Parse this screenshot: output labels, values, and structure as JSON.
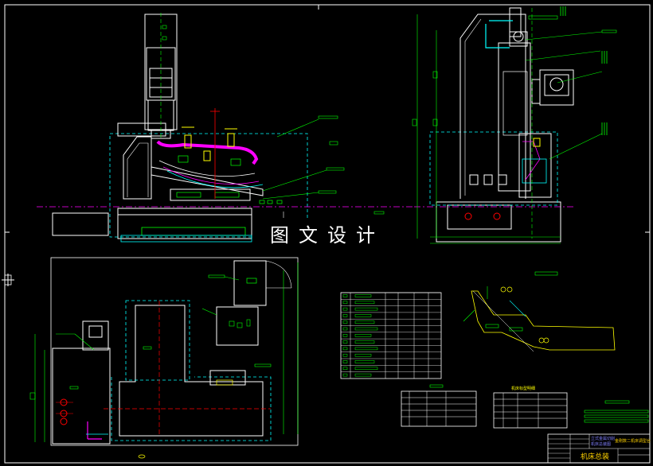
{
  "watermark": "图文设计",
  "title_block": {
    "drawing_name": "机床总装",
    "top_right_label": "金刚数二机床调型台",
    "top_left_label_1": "立式金属切削",
    "top_left_label_2": "机床总装图"
  },
  "tables": {
    "right_table_title": "机床标型明细"
  },
  "colors": {
    "background": "#000000",
    "frame": "#ffffff",
    "outline": "#ffffff",
    "green": "#00ff00",
    "cyan": "#00ffff",
    "yellow": "#ffff00",
    "red": "#ff0000",
    "magenta": "#ff00ff",
    "blue": "#4040ff"
  }
}
